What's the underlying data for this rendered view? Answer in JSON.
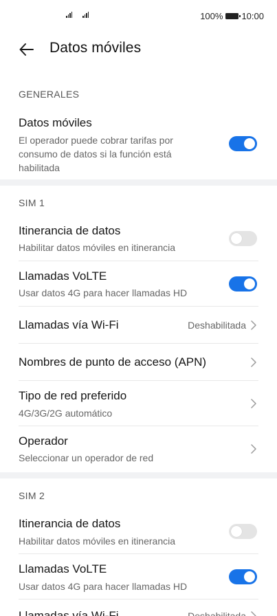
{
  "status_bar": {
    "battery_percent": "100%",
    "time": "10:00",
    "battery_level": 1.0
  },
  "header": {
    "title": "Datos móviles",
    "back_icon": "arrow-left-icon"
  },
  "sections": {
    "general": {
      "header": "GENERALES",
      "mobile_data": {
        "title": "Datos móviles",
        "sub_line1": "El operador puede cobrar tarifas por",
        "sub_line2": "consumo de datos si la función está",
        "sub_line3": "habilitada",
        "toggle_on": true
      }
    },
    "sim1": {
      "header": "SIM 1",
      "roaming": {
        "title": "Itinerancia de datos",
        "subtitle": "Habilitar datos móviles en itinerancia",
        "toggle_on": false
      },
      "volte": {
        "title": "Llamadas VoLTE",
        "subtitle": "Usar datos 4G para hacer llamadas HD",
        "toggle_on": true
      },
      "wifi_calls": {
        "title": "Llamadas vía Wi-Fi",
        "value": "Deshabilitada"
      },
      "apn": {
        "title": "Nombres de punto de acceso (APN)"
      },
      "network_type": {
        "title": "Tipo de red preferido",
        "subtitle": "4G/3G/2G automático"
      },
      "operator": {
        "title": "Operador",
        "subtitle": "Seleccionar un operador de red"
      }
    },
    "sim2": {
      "header": "SIM 2",
      "roaming": {
        "title": "Itinerancia de datos",
        "subtitle": "Habilitar datos móviles en itinerancia",
        "toggle_on": false
      },
      "volte": {
        "title": "Llamadas VoLTE",
        "subtitle": "Usar datos 4G para hacer llamadas HD",
        "toggle_on": true
      },
      "wifi_calls": {
        "title": "Llamadas vía Wi-Fi",
        "value": "Deshabilitada"
      }
    }
  },
  "colors": {
    "accent": "#1873e8",
    "toggle_off": "#e4e4e4",
    "band": "#f1f2f4"
  }
}
